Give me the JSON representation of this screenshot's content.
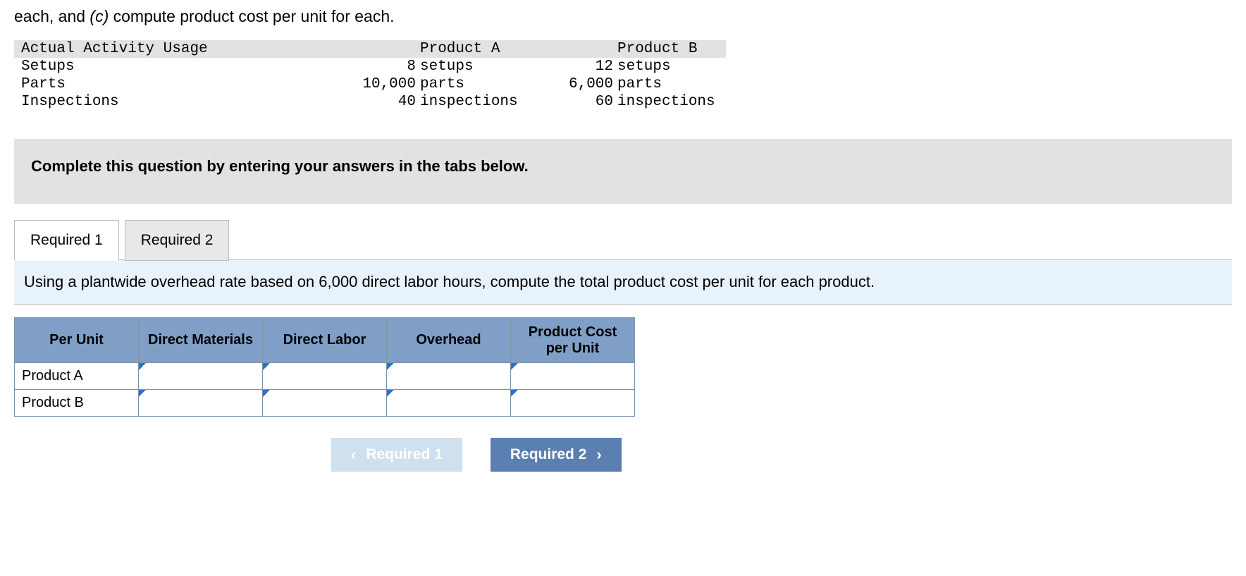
{
  "intro": {
    "prefix": "each, and ",
    "part_label": "(c)",
    "suffix": " compute product cost per unit for each."
  },
  "usage_table": {
    "headers": {
      "c0": "Actual Activity Usage",
      "c1": "Product A",
      "c2": "Product B"
    },
    "rows": [
      {
        "label": "Setups",
        "a_num": "8",
        "a_unit": "setups",
        "b_num": "12",
        "b_unit": "setups"
      },
      {
        "label": "Parts",
        "a_num": "10,000",
        "a_unit": "parts",
        "b_num": "6,000",
        "b_unit": "parts"
      },
      {
        "label": "Inspections",
        "a_num": "40",
        "a_unit": "inspections",
        "b_num": "60",
        "b_unit": "inspections"
      }
    ]
  },
  "instruction": "Complete this question by entering your answers in the tabs below.",
  "tabs": {
    "t1": "Required 1",
    "t2": "Required 2",
    "active": 0
  },
  "prompt": "Using a plantwide overhead rate based on 6,000 direct labor hours, compute the total product cost per unit for each product.",
  "answer_table": {
    "headers": [
      "Per Unit",
      "Direct Materials",
      "Direct Labor",
      "Overhead",
      "Product Cost per Unit"
    ],
    "rows": [
      "Product A",
      "Product B"
    ]
  },
  "nav": {
    "prev": "Required 1",
    "next": "Required 2"
  }
}
